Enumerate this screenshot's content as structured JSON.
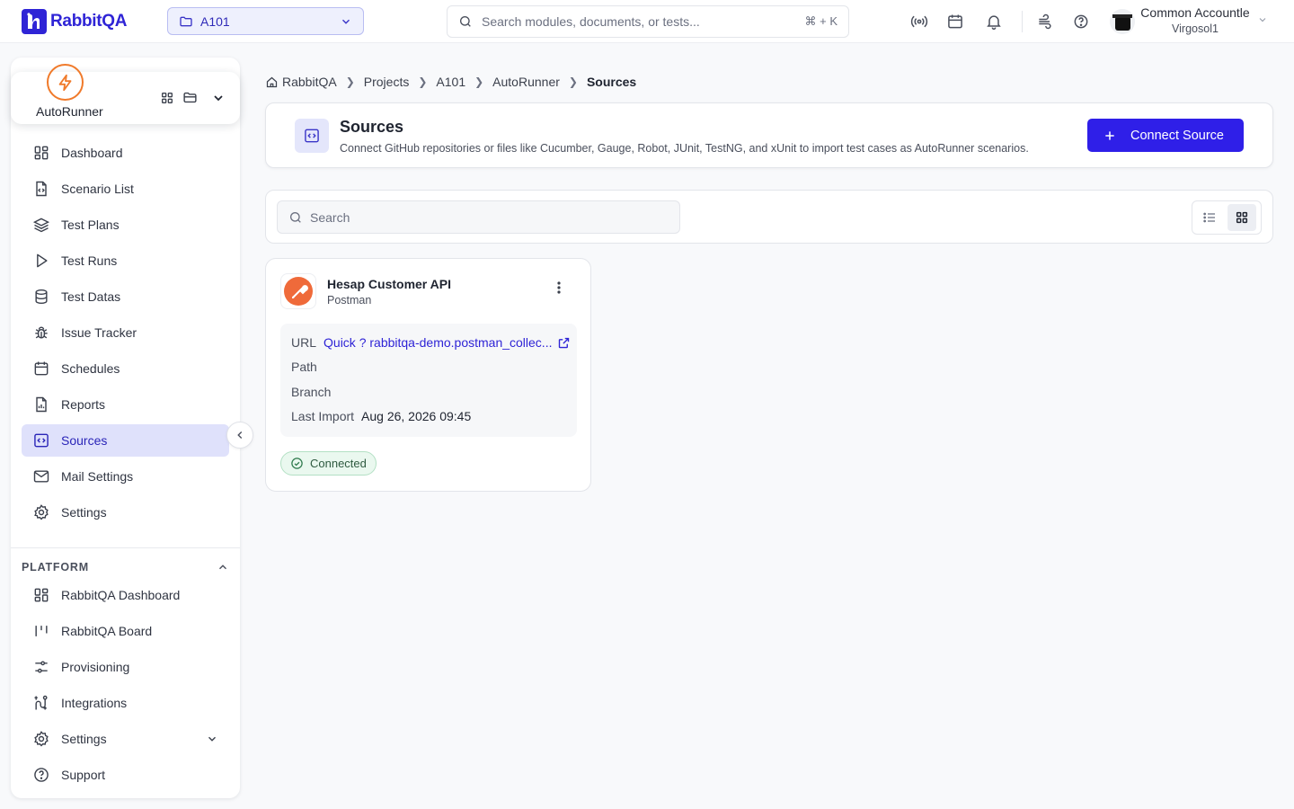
{
  "app": {
    "logo_text": "RabbitQA"
  },
  "topbar": {
    "project": "A101",
    "search_placeholder": "Search modules, documents, or tests...",
    "shortcut": "⌘ + K",
    "user_name": "Common Accountle",
    "user_org": "Virgosol1"
  },
  "sidebar": {
    "app_name": "AutoRunner",
    "items": [
      {
        "label": "Dashboard",
        "icon": "dashboard-icon"
      },
      {
        "label": "Scenario List",
        "icon": "file-code-icon"
      },
      {
        "label": "Test Plans",
        "icon": "layers-icon"
      },
      {
        "label": "Test Runs",
        "icon": "play-icon"
      },
      {
        "label": "Test Datas",
        "icon": "database-icon"
      },
      {
        "label": "Issue Tracker",
        "icon": "bug-icon"
      },
      {
        "label": "Schedules",
        "icon": "calendar-icon"
      },
      {
        "label": "Reports",
        "icon": "report-icon"
      },
      {
        "label": "Sources",
        "icon": "code-window-icon",
        "active": true
      },
      {
        "label": "Mail Settings",
        "icon": "mail-icon"
      },
      {
        "label": "Settings",
        "icon": "gear-icon"
      }
    ],
    "platform_heading": "PLATFORM",
    "platform_items": [
      {
        "label": "RabbitQA Dashboard",
        "icon": "dashboard-icon"
      },
      {
        "label": "RabbitQA Board",
        "icon": "board-icon"
      },
      {
        "label": "Provisioning",
        "icon": "sliders-icon"
      },
      {
        "label": "Integrations",
        "icon": "integrations-icon"
      },
      {
        "label": "Settings",
        "icon": "gear-icon"
      },
      {
        "label": "Support",
        "icon": "help-icon"
      }
    ]
  },
  "breadcrumb": [
    "RabbitQA",
    "Projects",
    "A101",
    "AutoRunner",
    "Sources"
  ],
  "page": {
    "title": "Sources",
    "description": "Connect GitHub repositories or files like Cucumber, Gauge, Robot, JUnit, TestNG, and xUnit to import test cases as AutoRunner scenarios.",
    "connect_button": "Connect Source",
    "search_placeholder": "Search",
    "view_mode": "grid"
  },
  "source": {
    "name": "Hesap Customer API",
    "type": "Postman",
    "url_label": "URL",
    "url_value": "Quick ? rabbitqa-demo.postman_collec...",
    "path_label": "Path",
    "branch_label": "Branch",
    "last_import_label": "Last Import",
    "last_import_value": "Aug 26, 2026 09:45",
    "status": "Connected"
  },
  "colors": {
    "primary": "#2f1fe8",
    "active_bg": "#dfe1fb",
    "success": "#2f7a4d",
    "postman": "#ef6a3a",
    "autorunner": "#f07a2a"
  }
}
